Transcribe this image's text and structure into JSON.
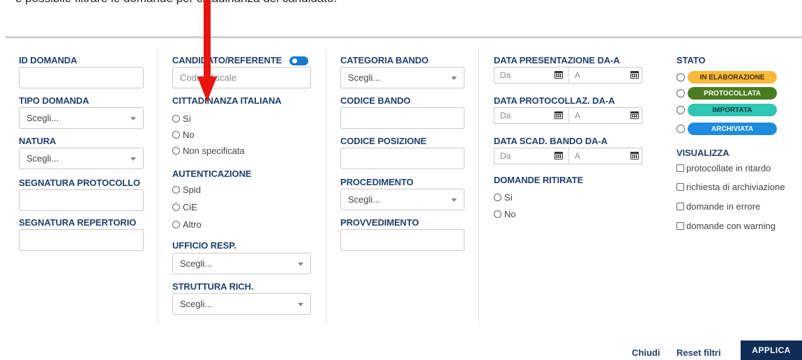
{
  "caption": "è possibile filtrare le domande per cittadinanza del candidato.",
  "col1": {
    "id_domanda": "ID DOMANDA",
    "tipo_domanda": "TIPO DOMANDA",
    "tipo_domanda_value": "Scegli...",
    "natura": "NATURA",
    "natura_value": "Scegli...",
    "segnatura_protocollo": "SEGNATURA PROTOCOLLO",
    "segnatura_repertorio": "SEGNATURA REPERTORIO"
  },
  "col2": {
    "candidato": "CANDIDATO/REFERENTE",
    "candidato_placeholder": "Codice fiscale",
    "cittadinanza": "CITTADINANZA ITALIANA",
    "cittadinanza_options": [
      "Sì",
      "No",
      "Non specificata"
    ],
    "autenticazione": "AUTENTICAZIONE",
    "autenticazione_options": [
      "Spid",
      "CiE",
      "Altro"
    ],
    "ufficio": "UFFICIO RESP.",
    "ufficio_value": "Scegli...",
    "struttura": "STRUTTURA RICH.",
    "struttura_value": "Scegli..."
  },
  "col3": {
    "categoria": "CATEGORIA BANDO",
    "categoria_value": "Scegli...",
    "codice_bando": "CODICE BANDO",
    "codice_posizione": "CODICE POSIZIONE",
    "procedimento": "PROCEDIMENTO",
    "procedimento_value": "Scegli...",
    "provvedimento": "PROVVEDIMENTO"
  },
  "col4": {
    "data_presentazione": "DATA PRESENTAZIONE DA-A",
    "data_protocollaz": "DATA PROTOCOLLAZ. DA-A",
    "data_scad": "DATA SCAD. BANDO DA-A",
    "from_placeholder": "Da",
    "to_placeholder": "A",
    "ritirate": "DOMANDE RITIRATE",
    "ritirate_options": [
      "Sì",
      "No"
    ]
  },
  "col5": {
    "stato": "STATO",
    "stati": [
      {
        "label": "IN ELABORAZIONE",
        "bg": "#f6b93b",
        "fg": "#4a2e00"
      },
      {
        "label": "PROTOCOLLATA",
        "bg": "#4a7d1f",
        "fg": "#ffffff"
      },
      {
        "label": "IMPORTATA",
        "bg": "#2ec6b5",
        "fg": "#0c3d44"
      },
      {
        "label": "ARCHIVIATA",
        "bg": "#1d8be0",
        "fg": "#ffffff"
      }
    ],
    "visualizza": "VISUALIZZA",
    "visualizza_options": [
      "protocollate in ritardo",
      "richiesta di archiviazione",
      "domande in errore",
      "domande con warning"
    ]
  },
  "footer": {
    "chiudi": "Chiudi",
    "reset": "Reset filtri",
    "applica": "APPLICA"
  },
  "colors": {
    "label": "#1f3f6e",
    "apply_bg": "#0f2d57",
    "toggle": "#1a7ac9",
    "arrow": "#e8140f"
  }
}
